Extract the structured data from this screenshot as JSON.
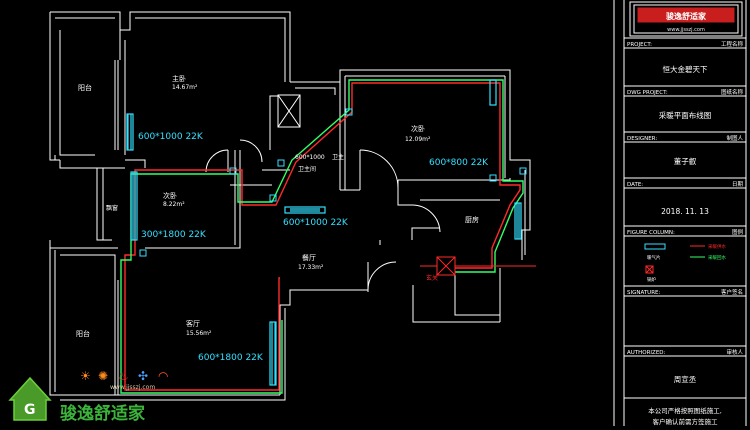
{
  "colors": {
    "background": "#000000",
    "wall": "#ffffff",
    "heat_supply": "#ff2a2a",
    "heat_return": "#33ff66",
    "radiator": "#33e0ff",
    "dim_text": "#ffffff"
  },
  "rooms": {
    "balcony_top": "阳台",
    "master_bedroom": "主卧",
    "master_bedroom_area": "14.67m²",
    "bedroom_right": "次卧",
    "bedroom_right_area": "12.09m²",
    "master_bath_a": "卫主",
    "master_bath_b": "卫主间",
    "bedroom_small": "次卧",
    "bedroom_small_area": "8.22m²",
    "bay_window": "飘窗",
    "kitchen": "厨房",
    "dining": "餐厅",
    "dining_area": "17.33m²",
    "entrance": "玄关",
    "balcony_bottom": "阳台",
    "living": "客厅",
    "living_area": "15.56m²"
  },
  "radiators": {
    "r1": "600*1000 22K",
    "r2": "600*800 22K",
    "r3": "600*1000 22K",
    "r4": "300*1800 22K",
    "r5": "600*1800 22K",
    "bath": "600*1000"
  },
  "title_block": {
    "project_label": "PROJECT:",
    "project_label_cn": "工程名称",
    "project_value": "恒大金碧天下",
    "dwg_label": "DWG PROJECT:",
    "dwg_label_cn": "图纸名称",
    "dwg_value": "采暖平面布线图",
    "designer_label": "DESIGNER:",
    "designer_label_cn": "制图人",
    "designer_value": "董子叡",
    "date_label": "DATE:",
    "date_label_cn": "日期",
    "date_value": "2018. 11. 13",
    "figure_label": "FIGURE COLUMN:",
    "figure_label_cn": "图例",
    "legend_radiator": "暖气片",
    "legend_supply": "采暖供水",
    "legend_return": "采暖回水",
    "legend_boiler": "锅炉",
    "signature_label": "SIGNATURE:",
    "signature_label_cn": "客户签名",
    "authorized_label": "AUTHORIZED:",
    "authorized_label_cn": "审核人",
    "authorized_value": "周宣丞",
    "footer_note_1": "本公司严格按照图纸施工,",
    "footer_note_2": "客户确认前需方签施工"
  },
  "logo": {
    "top_text": "www.jjsszj.com",
    "brand_cn": "骏逸舒适家",
    "watermark": "www.jjsszj.com"
  }
}
